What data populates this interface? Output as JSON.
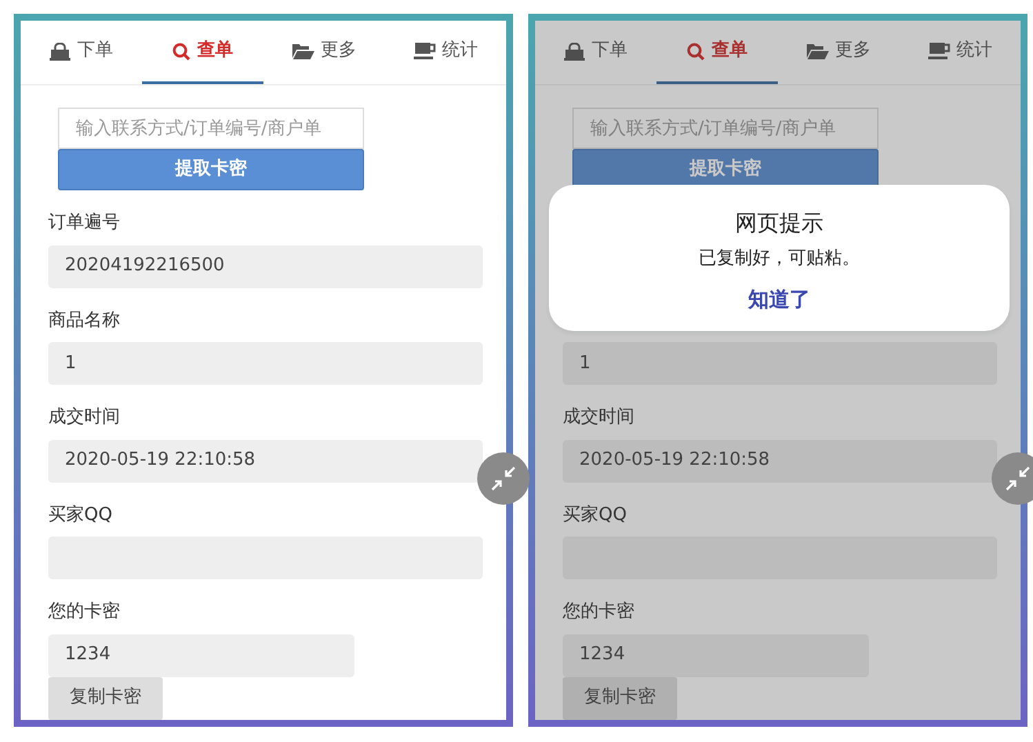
{
  "screens": [
    {
      "dimmed": false,
      "tabs": [
        {
          "label": "下单",
          "selected": false
        },
        {
          "label": "查单",
          "selected": true
        },
        {
          "label": "更多",
          "selected": false
        },
        {
          "label": "统计",
          "selected": false
        }
      ],
      "search": {
        "placeholder": "输入联系方式/订单编号/商户单"
      },
      "submit_button": "提取卡密",
      "fields": [
        {
          "label": "订单遍号",
          "value": "20204192216500"
        },
        {
          "label": "商品名称",
          "value": "1"
        },
        {
          "label": "成交时间",
          "value": "2020-05-19 22:10:58"
        },
        {
          "label": "买家QQ"
        },
        {
          "label": "您的卡密",
          "value": "1234",
          "kind": "short"
        }
      ],
      "copy_button": "复制卡密"
    },
    {
      "dimmed": true,
      "tabs": [
        {
          "label": "下单",
          "selected": false
        },
        {
          "label": "查单",
          "selected": true
        },
        {
          "label": "更多",
          "selected": false
        },
        {
          "label": "统计",
          "selected": false
        }
      ],
      "search": {
        "placeholder": "输入联系方式/订单编号/商户单"
      },
      "submit_button": "提取卡密",
      "dialog": {
        "title": "网页提示",
        "message": "已复制好，可贴粘。",
        "button": "知道了"
      },
      "fields": [
        {
          "value": "1"
        },
        {
          "label": "成交时间",
          "value": "2020-05-19 22:10:58"
        },
        {
          "label": "买家QQ"
        },
        {
          "label": "您的卡密",
          "value": "1234",
          "kind": "short"
        }
      ],
      "copy_button": "复制卡密"
    }
  ]
}
